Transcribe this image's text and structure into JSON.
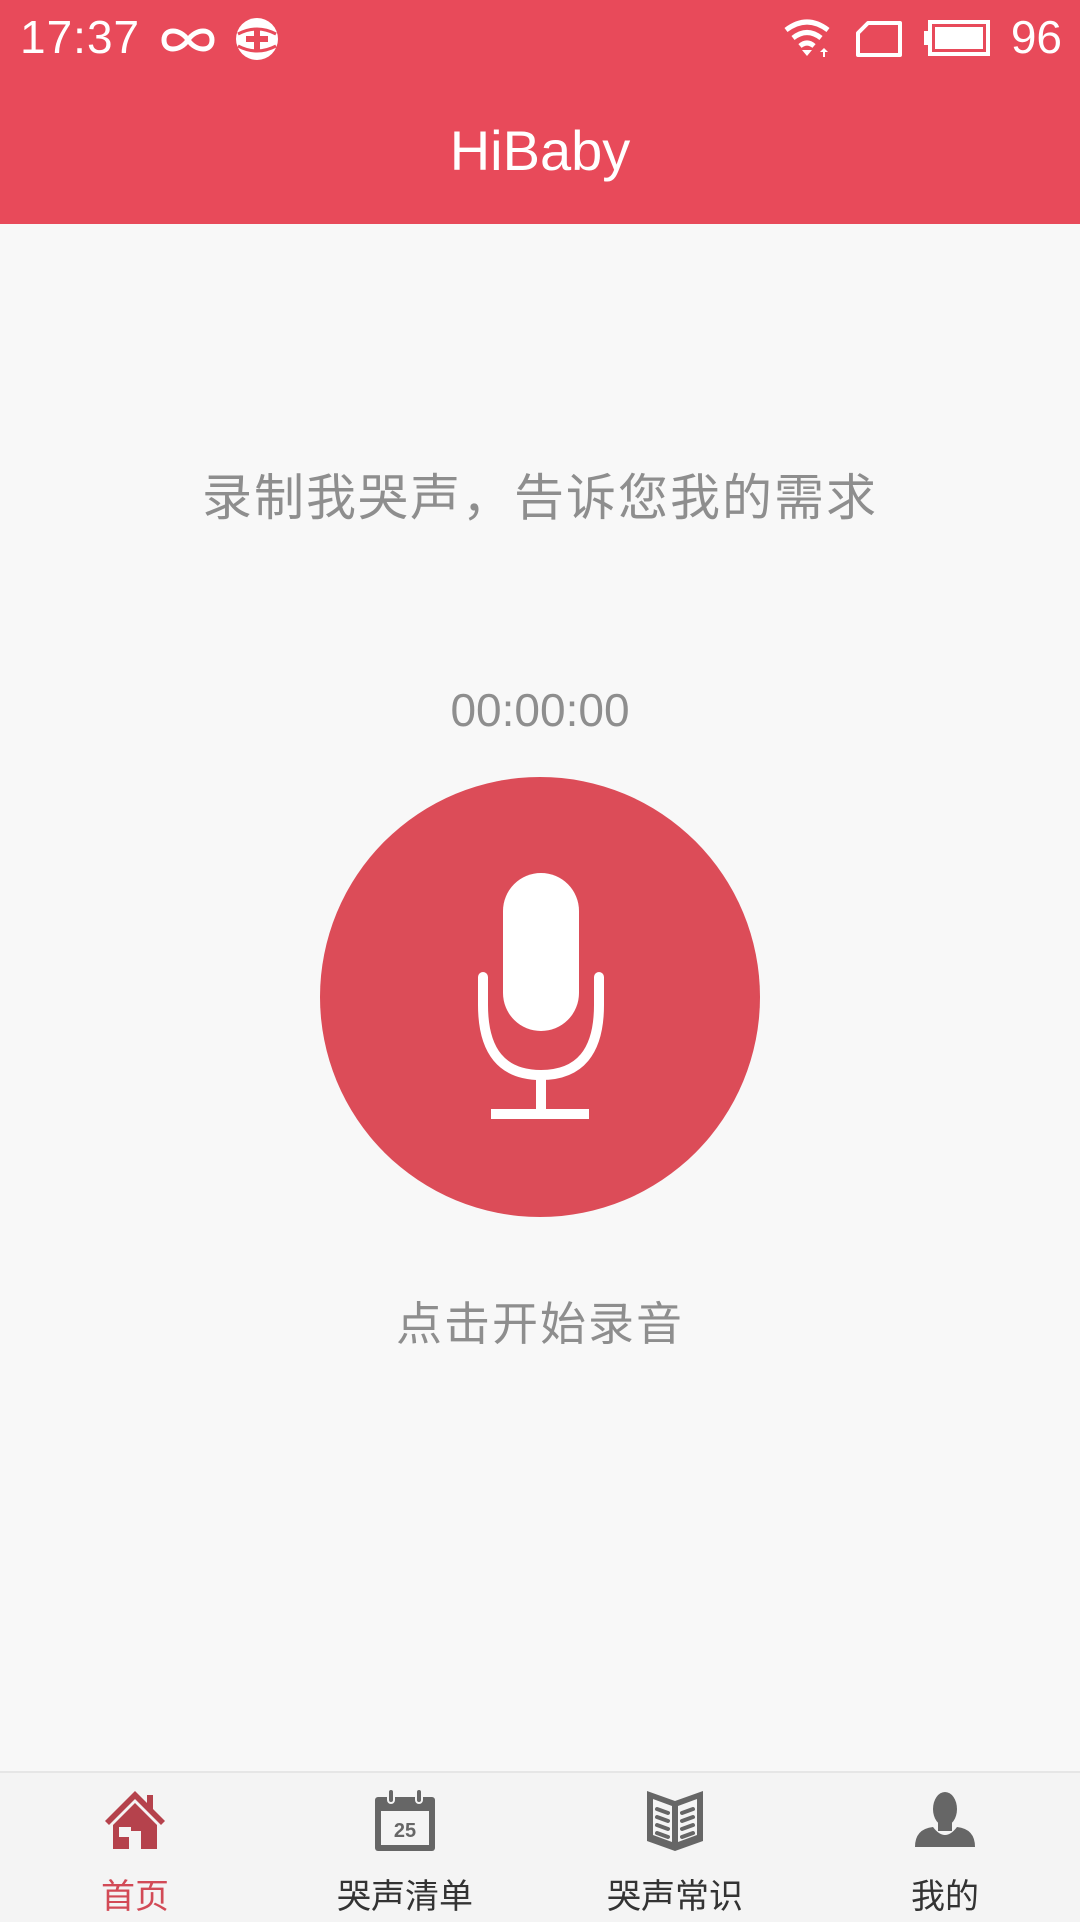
{
  "status_bar": {
    "time": "17:37",
    "left_icons": [
      "infinity-icon",
      "health-plus-icon"
    ],
    "right_icons": [
      "wifi-icon",
      "sim-card-icon",
      "battery-icon"
    ],
    "battery_level": "96"
  },
  "app_bar": {
    "title": "HiBaby"
  },
  "main": {
    "prompt": "录制我哭声，告诉您我的需求",
    "timer": "00:00:00",
    "record_button_icon": "microphone-icon",
    "hint": "点击开始录音"
  },
  "colors": {
    "primary": "#e84a5a",
    "record_button": "#dc4c58",
    "active_nav": "#d24a56",
    "inactive_icon": "#666666",
    "secondary_text": "#8e8e8e"
  },
  "bottom_nav": {
    "items": [
      {
        "label": "首页",
        "icon": "home-icon",
        "active": true
      },
      {
        "label": "哭声清单",
        "icon": "calendar-icon",
        "calendar_day": "25",
        "active": false
      },
      {
        "label": "哭声常识",
        "icon": "book-icon",
        "active": false
      },
      {
        "label": "我的",
        "icon": "user-icon",
        "active": false
      }
    ]
  }
}
